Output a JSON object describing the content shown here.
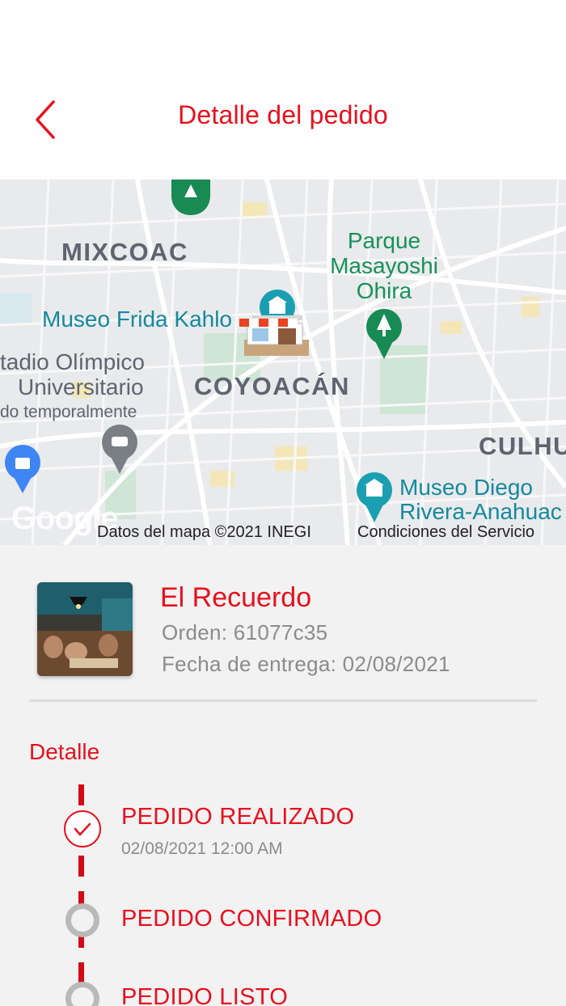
{
  "header": {
    "title": "Detalle del pedido",
    "back_icon": "chevron-left-icon"
  },
  "map": {
    "labels": {
      "mixcoac": "MIXCOAC",
      "coyoacan": "COYOACÁN",
      "culhuacan": "CULHU",
      "parque_1": "Parque",
      "parque_2": "Masayoshi",
      "parque_3": "Ohira",
      "frida": "Museo Frida Kahlo",
      "estadio_1": "tadio Olímpico",
      "estadio_2": "Universitario",
      "estadio_3": "do temporalmente",
      "diego_1": "Museo Diego",
      "diego_2": "Rivera-Anahuac"
    },
    "google": "Google",
    "attribution": "Datos del mapa ©2021 INEGI",
    "terms": "Condiciones del Servicio",
    "store_marker_icon": "store-icon"
  },
  "order": {
    "store_name": "El Recuerdo",
    "order_label": "Orden: 61077c35",
    "delivery_label": "Fecha de entrega: 02/08/2021"
  },
  "detail": {
    "title": "Detalle",
    "steps": [
      {
        "label": "PEDIDO REALIZADO",
        "time": "02/08/2021 12:00 AM",
        "done": true
      },
      {
        "label": "PEDIDO CONFIRMADO",
        "done": false
      },
      {
        "label": "PEDIDO LISTO",
        "done": false
      }
    ]
  },
  "colors": {
    "accent": "#e8101e",
    "muted_text": "#8b8b8b",
    "content_bg": "#f2f2f2"
  }
}
